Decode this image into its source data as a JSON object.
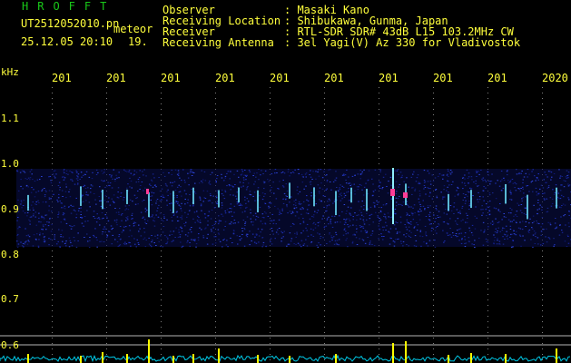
{
  "header": {
    "app_title": "HROFFT",
    "file_name": "UT2512052010.pn",
    "file_suffix": "meteor",
    "datetime": "25.12.05 20:10",
    "count": "19."
  },
  "info": [
    {
      "label": "Observer",
      "value": ": Masaki Kano"
    },
    {
      "label": "Receiving Location",
      "value": ": Shibukawa, Gunma, Japan"
    },
    {
      "label": "Receiver",
      "value": ": RTL-SDR SDR# 43dB L15 103.2MHz CW"
    },
    {
      "label": "Receiving Antenna",
      "value": ": 3el Yagi(V) Az 330 for Vladivostok"
    }
  ],
  "axes": {
    "y_unit": "kHz",
    "y_ticks": [
      "1.1",
      "1.0",
      "0.9",
      "0.8",
      "0.7",
      "0.6"
    ],
    "x_ticks": [
      "201",
      "201",
      "201",
      "201",
      "201",
      "201",
      "201",
      "201",
      "201",
      "2020"
    ]
  },
  "colors": {
    "label_text": "#ffff3c",
    "title_text": "#19c919",
    "noise_band": "#1a2aa8",
    "echo_bright": "#ff3c96",
    "level_trace": "#00c8e6",
    "level_spike": "#ffff00"
  }
}
